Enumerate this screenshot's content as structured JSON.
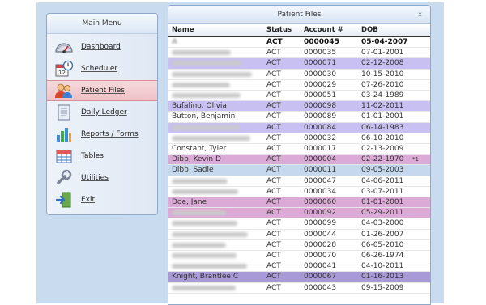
{
  "main_menu": {
    "title": "Main Menu",
    "items": [
      {
        "label": "Dashboard",
        "icon": "speedometer-icon"
      },
      {
        "label": "Scheduler",
        "icon": "calendar-clock-icon"
      },
      {
        "label": "Patient Files",
        "icon": "users-icon",
        "active": true
      },
      {
        "label": "Daily Ledger",
        "icon": "ledger-book-icon"
      },
      {
        "label": "Reports / Forms",
        "icon": "bar-chart-icon"
      },
      {
        "label": "Tables",
        "icon": "table-grid-icon"
      },
      {
        "label": "Utilities",
        "icon": "wrench-icon"
      },
      {
        "label": "Exit",
        "icon": "exit-door-icon"
      }
    ]
  },
  "patient_files": {
    "title": "Patient Files",
    "close_label": "x",
    "columns": [
      "Name",
      "Status",
      "Account #",
      "DOB"
    ],
    "rows": [
      {
        "name": "A",
        "status": "ACT",
        "account": "0000045",
        "dob": "05-04-2007",
        "bold": true,
        "bg": "#ffffff",
        "blur": true
      },
      {
        "name": "",
        "status": "ACT",
        "account": "0000035",
        "dob": "07-01-2001",
        "bg": "#ffffff",
        "blur": true
      },
      {
        "name": "",
        "status": "ACT",
        "account": "0000071",
        "dob": "02-12-2008",
        "bg": "#c8c0f0",
        "blur": true
      },
      {
        "name": "",
        "status": "ACT",
        "account": "0000030",
        "dob": "10-15-2010",
        "bg": "#ffffff",
        "blur": true
      },
      {
        "name": "",
        "status": "ACT",
        "account": "0000029",
        "dob": "07-26-2010",
        "bg": "#ffffff",
        "blur": true
      },
      {
        "name": "",
        "status": "ACT",
        "account": "0000051",
        "dob": "03-24-1989",
        "bg": "#ffffff",
        "blur": true
      },
      {
        "name": "Bufalino, Olivia",
        "status": "ACT",
        "account": "0000098",
        "dob": "11-02-2011",
        "bg": "#c8c0f0"
      },
      {
        "name": "Button, Benjamin",
        "status": "ACT",
        "account": "0000089",
        "dob": "01-01-2001",
        "bg": "#ffffff"
      },
      {
        "name": "",
        "status": "ACT",
        "account": "0000084",
        "dob": "06-14-1983",
        "bg": "#c8c0f0",
        "blur": true
      },
      {
        "name": "",
        "status": "ACT",
        "account": "0000032",
        "dob": "06-10-2010",
        "bg": "#ffffff",
        "blur": true
      },
      {
        "name": "Constant, Tyler",
        "status": "ACT",
        "account": "0000017",
        "dob": "02-13-2009",
        "bg": "#ffffff"
      },
      {
        "name": "Dibb, Kevin D",
        "status": "ACT",
        "account": "0000004",
        "dob": "02-22-1970",
        "bg": "#dcaad6",
        "flag": "*1"
      },
      {
        "name": "Dibb, Sadie",
        "status": "ACT",
        "account": "0000011",
        "dob": "09-05-2003",
        "bg": "#c5d8ee"
      },
      {
        "name": "",
        "status": "ACT",
        "account": "0000047",
        "dob": "04-06-2011",
        "bg": "#ffffff",
        "blur": true
      },
      {
        "name": "",
        "status": "ACT",
        "account": "0000034",
        "dob": "03-07-2011",
        "bg": "#ffffff",
        "blur": true
      },
      {
        "name": "Doe, Jane",
        "status": "ACT",
        "account": "0000060",
        "dob": "01-01-2001",
        "bg": "#dcaad6"
      },
      {
        "name": "",
        "status": "ACT",
        "account": "0000092",
        "dob": "05-29-2011",
        "bg": "#dcaad6",
        "blur": true
      },
      {
        "name": "",
        "status": "ACT",
        "account": "0000099",
        "dob": "04-03-2000",
        "bg": "#ffffff",
        "blur": true
      },
      {
        "name": "",
        "status": "ACT",
        "account": "0000044",
        "dob": "01-26-2007",
        "bg": "#ffffff",
        "blur": true
      },
      {
        "name": "",
        "status": "ACT",
        "account": "0000028",
        "dob": "06-05-2010",
        "bg": "#ffffff",
        "blur": true
      },
      {
        "name": "",
        "status": "ACT",
        "account": "0000070",
        "dob": "06-26-1974",
        "bg": "#ffffff",
        "blur": true
      },
      {
        "name": "",
        "status": "ACT",
        "account": "0000041",
        "dob": "04-10-2011",
        "bg": "#ffffff",
        "blur": true
      },
      {
        "name": "Knight, Brantlee C",
        "status": "ACT",
        "account": "0000067",
        "dob": "01-16-2013",
        "bg": "#a89ad6"
      },
      {
        "name": "",
        "status": "ACT",
        "account": "0000043",
        "dob": "09-15-2009",
        "bg": "#ffffff",
        "blur": true
      }
    ]
  },
  "colors": {
    "app_background": "#c9dbef",
    "active_menu": "#eec2c6",
    "lavender_row": "#c8c0f0",
    "pink_row": "#dcaad6",
    "blue_row": "#c5d8ee",
    "selected_row": "#a89ad6"
  }
}
